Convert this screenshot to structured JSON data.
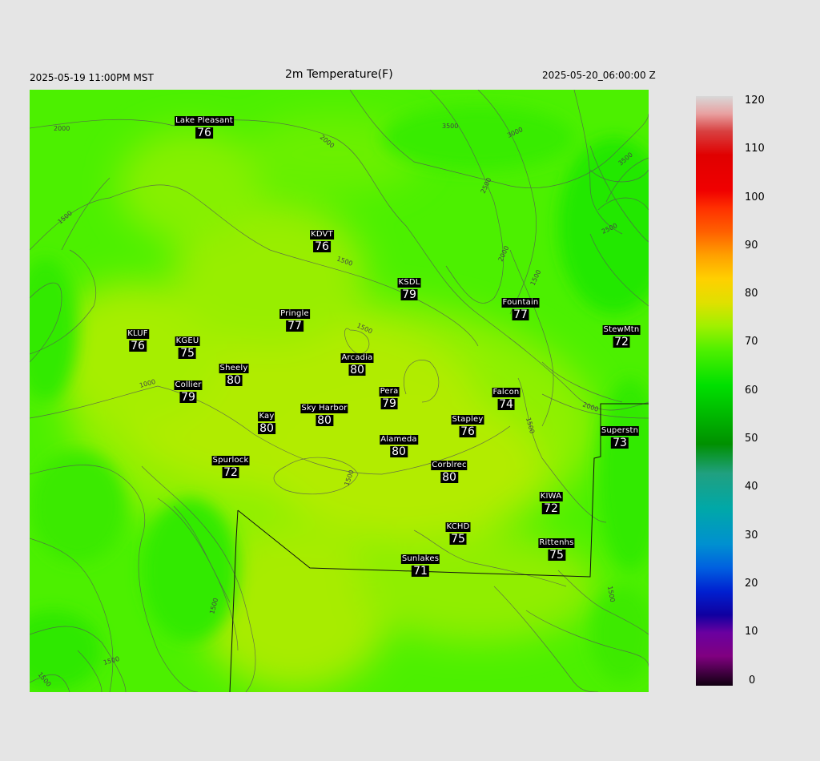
{
  "header": {
    "local_time": "2025-05-19 11:00PM MST",
    "title": "2m Temperature(F)",
    "utc_time": "2025-05-20_06:00:00 Z"
  },
  "colorbar": {
    "ticks": [
      "120",
      "110",
      "100",
      "90",
      "80",
      "70",
      "60",
      "50",
      "40",
      "30",
      "20",
      "10",
      "0"
    ],
    "min": 0,
    "max": 120
  },
  "contour_labels": [
    "2000",
    "2000",
    "3500",
    "3000",
    "3500",
    "2500",
    "1500",
    "2500",
    "2000",
    "1500",
    "1500",
    "1500",
    "1000",
    "2000",
    "1500",
    "1500",
    "1500",
    "1500",
    "1500",
    "1500"
  ],
  "stations": [
    {
      "name": "Lake Pleasant",
      "value": "76"
    },
    {
      "name": "KDVT",
      "value": "76"
    },
    {
      "name": "KSDL",
      "value": "79"
    },
    {
      "name": "Fountain",
      "value": "77"
    },
    {
      "name": "Pringle",
      "value": "77"
    },
    {
      "name": "KLUF",
      "value": "76"
    },
    {
      "name": "KGEU",
      "value": "75"
    },
    {
      "name": "Arcadia",
      "value": "80"
    },
    {
      "name": "StewMtn",
      "value": "72"
    },
    {
      "name": "Sheely",
      "value": "80"
    },
    {
      "name": "Collier",
      "value": "79"
    },
    {
      "name": "Pera",
      "value": "79"
    },
    {
      "name": "Falcon",
      "value": "74"
    },
    {
      "name": "Sky Harbor",
      "value": "80"
    },
    {
      "name": "Kay",
      "value": "80"
    },
    {
      "name": "Stapley",
      "value": "76"
    },
    {
      "name": "Superstn",
      "value": "73"
    },
    {
      "name": "Alameda",
      "value": "80"
    },
    {
      "name": "Spurlock",
      "value": "72"
    },
    {
      "name": "Corblrec",
      "value": "80"
    },
    {
      "name": "KIWA",
      "value": "72"
    },
    {
      "name": "KCHD",
      "value": "75"
    },
    {
      "name": "Rittenhs",
      "value": "75"
    },
    {
      "name": "Sunlakes",
      "value": "71"
    }
  ]
}
